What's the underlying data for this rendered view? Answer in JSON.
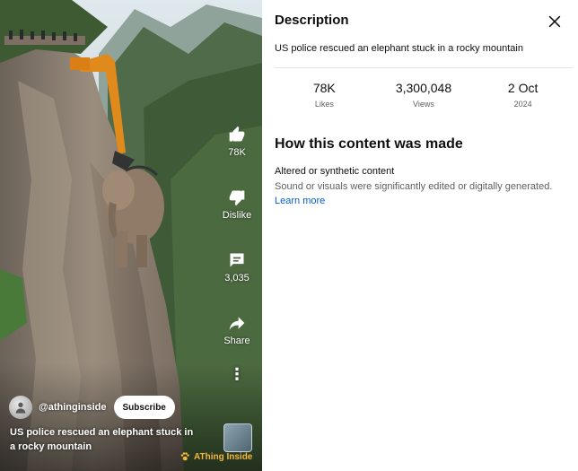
{
  "video": {
    "actions": [
      {
        "id": "like",
        "label": "78K"
      },
      {
        "id": "dislike",
        "label": "Dislike"
      },
      {
        "id": "comments",
        "label": "3,035"
      },
      {
        "id": "share",
        "label": "Share"
      }
    ],
    "more_glyph": "⋮",
    "channel": {
      "handle": "@athinginside",
      "subscribe_label": "Subscribe"
    },
    "title": "US police rescued an elephant stuck in a rocky mountain",
    "watermark": "AThing Inside"
  },
  "description_panel": {
    "title": "Description",
    "text": "US police rescued an elephant stuck in a rocky mountain",
    "stats": [
      {
        "value": "78K",
        "caption": "Likes"
      },
      {
        "value": "3,300,048",
        "caption": "Views"
      },
      {
        "value": "2 Oct",
        "caption": "2024"
      }
    ],
    "how_made": {
      "heading": "How this content was made",
      "label": "Altered or synthetic content",
      "body": "Sound or visuals were significantly edited or digitally generated.",
      "link": "Learn more"
    }
  },
  "colors": {
    "link": "#065fd4",
    "watermark": "#f3b73a",
    "text_secondary": "#606060"
  }
}
